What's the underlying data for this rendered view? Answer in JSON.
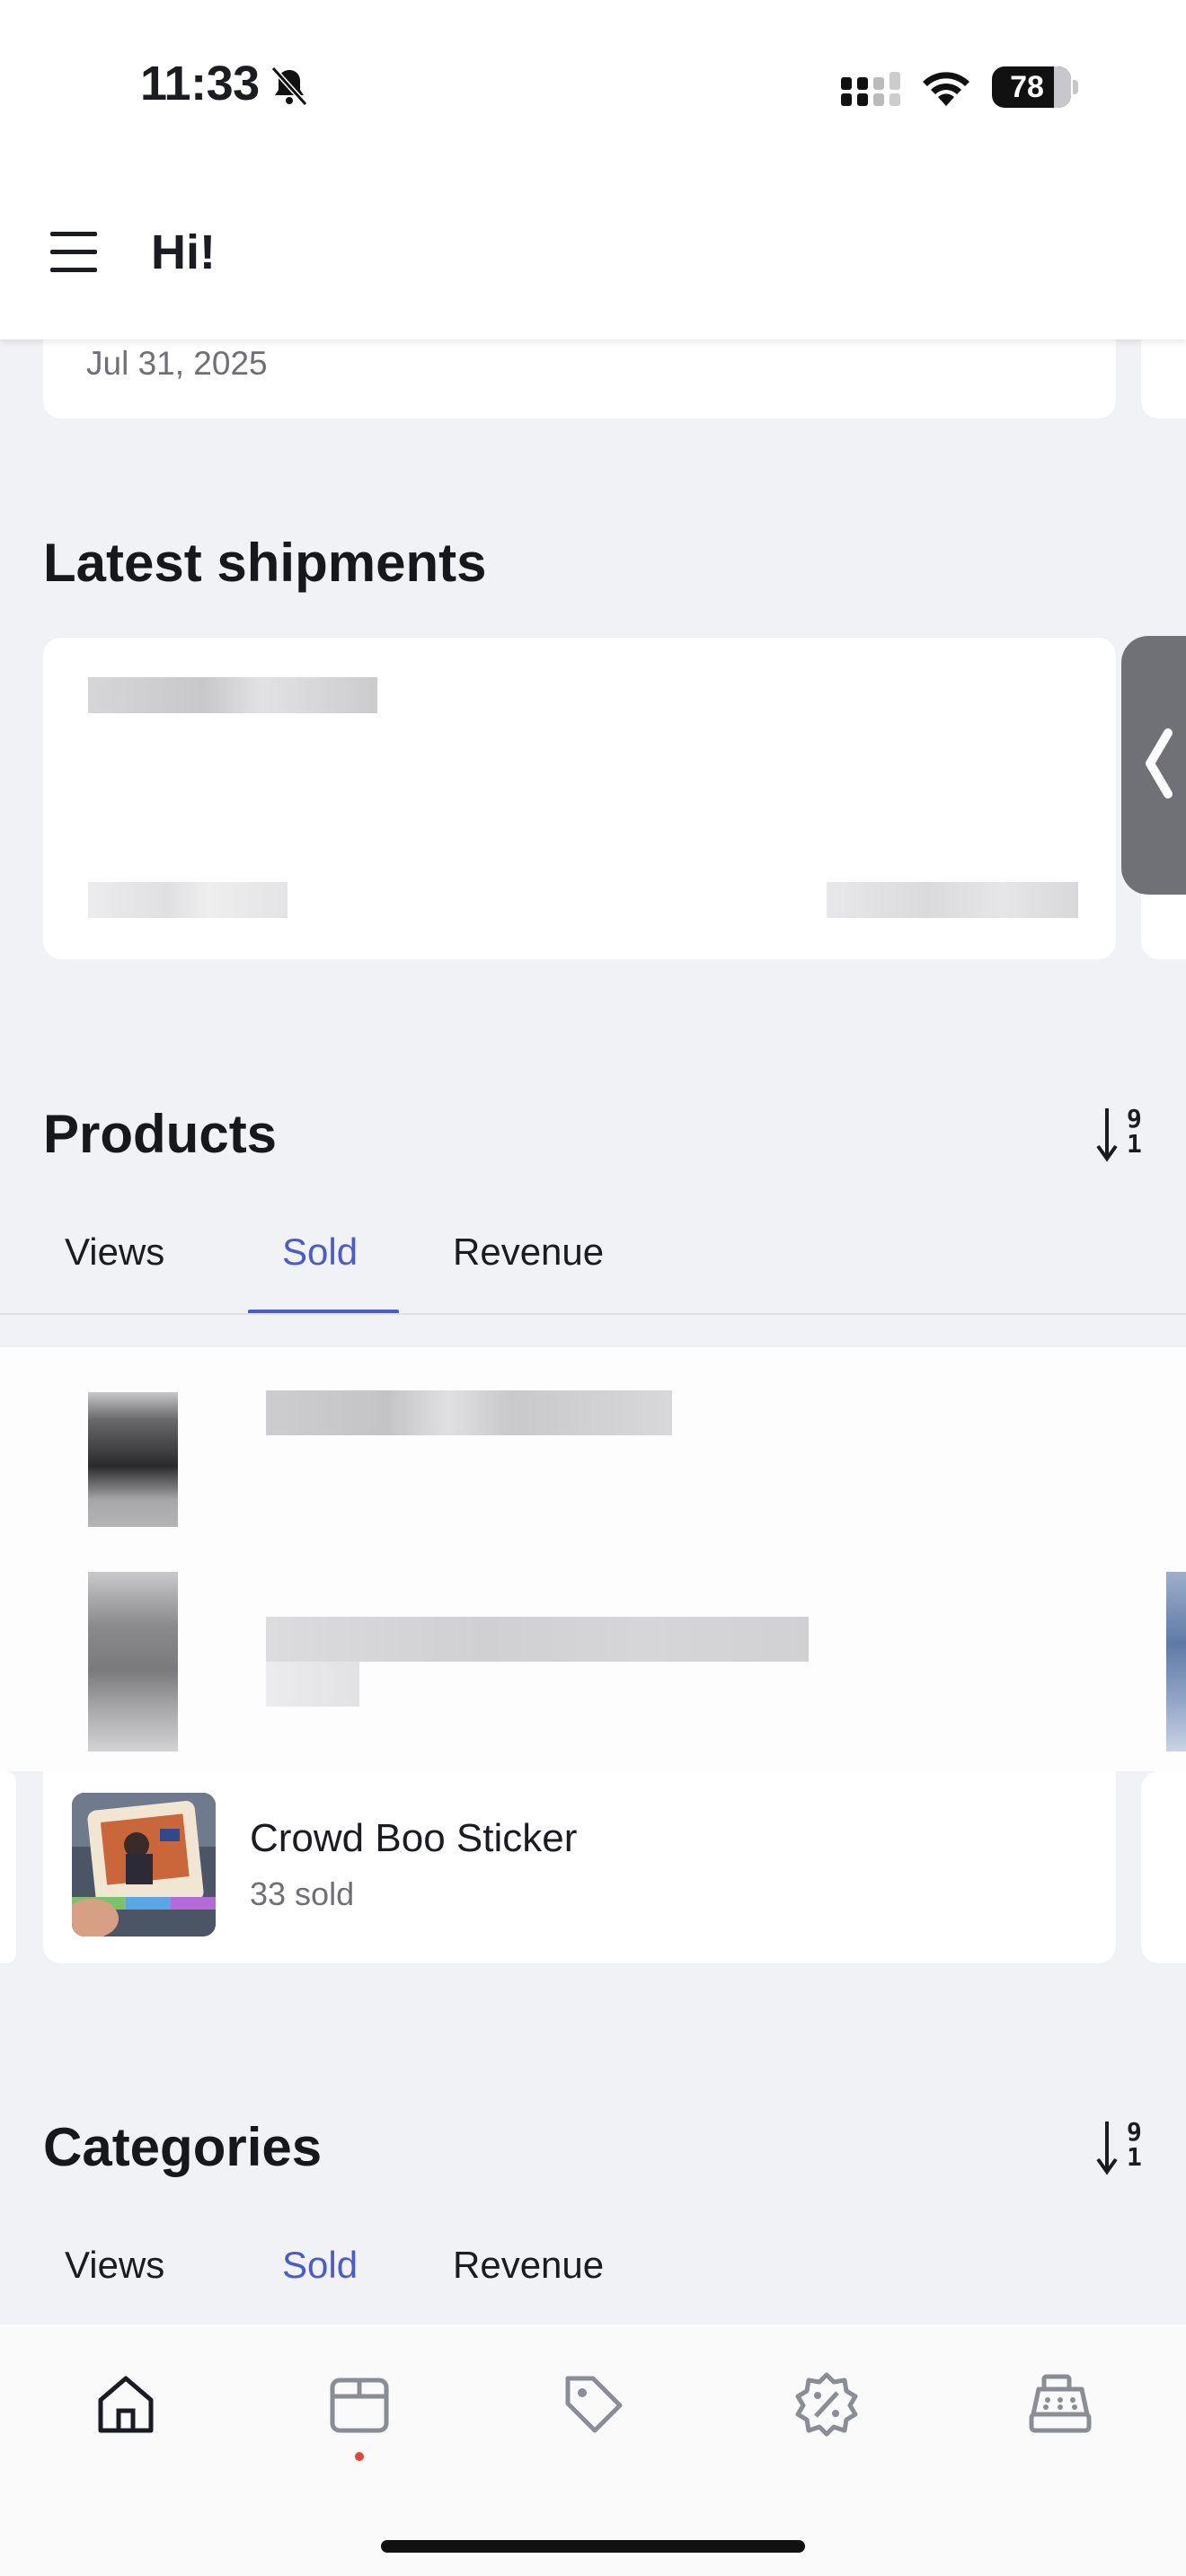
{
  "status_bar": {
    "time": "11:33",
    "battery_level": "78",
    "battery_fraction": 0.78
  },
  "header": {
    "greeting": "Hi!"
  },
  "top_card": {
    "date": "Jul 31, 2025"
  },
  "shipments": {
    "title": "Latest shipments"
  },
  "products": {
    "title": "Products",
    "tabs": [
      "Views",
      "Sold",
      "Revenue"
    ],
    "active_tab": "Sold",
    "sort_top": "9",
    "sort_bottom": "1",
    "items": [
      {
        "name": "Crowd Boo Sticker",
        "meta": "33 sold"
      }
    ]
  },
  "categories": {
    "title": "Categories",
    "tabs": [
      "Views",
      "Sold",
      "Revenue"
    ],
    "active_tab": "Sold",
    "sort_top": "9",
    "sort_bottom": "1"
  },
  "bottom_nav": {
    "items": [
      "home-icon",
      "box-icon",
      "tag-icon",
      "discount-icon",
      "register-icon"
    ],
    "active": "home-icon"
  },
  "colors": {
    "accent": "#4a5cc8",
    "background": "#f1f2f6",
    "notification_dot": "#e0453e"
  }
}
